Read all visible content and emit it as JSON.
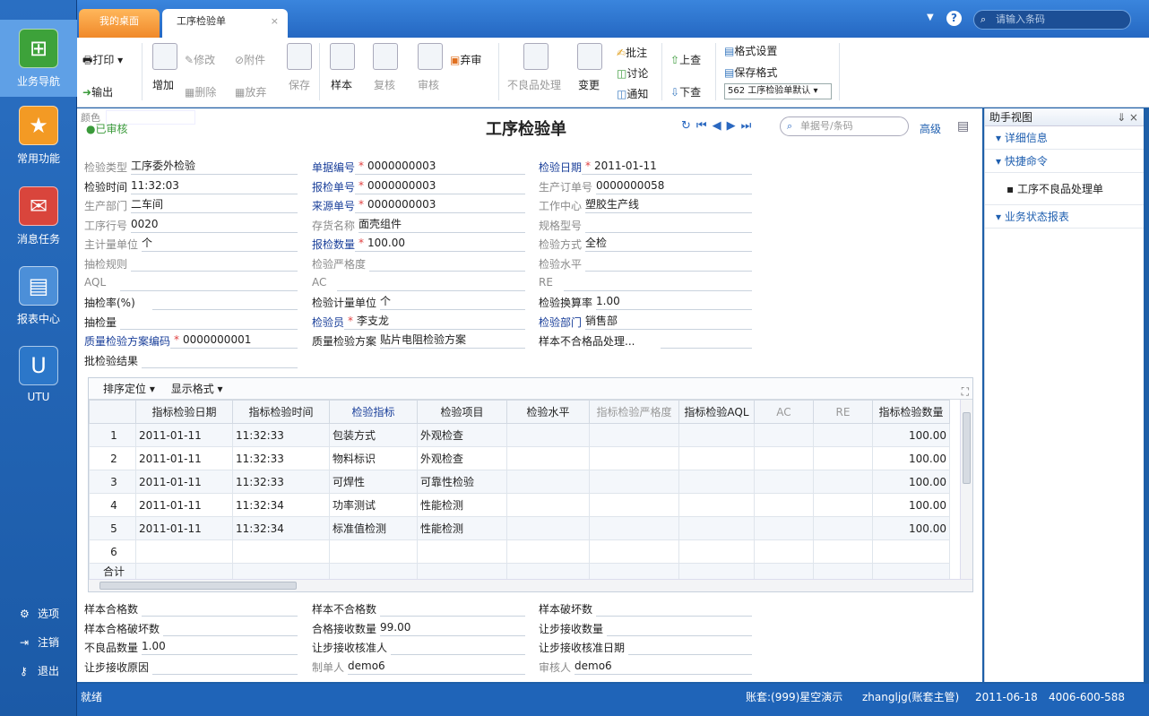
{
  "nav": {
    "items": [
      {
        "label": "业务导航"
      },
      {
        "label": "常用功能"
      },
      {
        "label": "消息任务"
      },
      {
        "label": "报表中心"
      },
      {
        "label": "UTU"
      }
    ],
    "bottom": [
      {
        "label": "选项"
      },
      {
        "label": "注销"
      },
      {
        "label": "退出"
      }
    ]
  },
  "tabs": {
    "home": "我的桌面",
    "current": "工序检验单"
  },
  "search": {
    "placeholder": "请输入条码"
  },
  "toolbar": {
    "print": "打印",
    "export": "输出",
    "add": "增加",
    "edit": "修改",
    "attach": "附件",
    "delete": "删除",
    "abandon": "放弃",
    "save": "保存",
    "sample": "样本",
    "recheck": "复核",
    "audit": "审核",
    "discard": "弃审",
    "defect": "不良品处理",
    "change": "变更",
    "annotate": "批注",
    "discuss": "讨论",
    "notify": "通知",
    "up": "上查",
    "down": "下查",
    "format_set": "格式设置",
    "save_format": "保存格式",
    "format_select": "562 工序检验单默认"
  },
  "doc": {
    "status": "已审核",
    "color_label": "颜色",
    "title": "工序检验单",
    "search_placeholder": "单据号/条码",
    "advanced": "高级"
  },
  "form": {
    "r1": [
      [
        "检验类型",
        "工序委外检验"
      ],
      [
        "单据编号",
        "0000000003"
      ],
      [
        "检验日期",
        "2011-01-11"
      ]
    ],
    "r2": [
      [
        "检验时间",
        "11:32:03"
      ],
      [
        "报检单号",
        "0000000003"
      ],
      [
        "生产订单号",
        "0000000058"
      ]
    ],
    "r3": [
      [
        "生产部门",
        "二车间"
      ],
      [
        "来源单号",
        "0000000003"
      ],
      [
        "工作中心",
        "塑胶生产线"
      ]
    ],
    "r4": [
      [
        "工序行号",
        "0020"
      ],
      [
        "存货名称",
        "面壳组件"
      ],
      [
        "规格型号",
        ""
      ]
    ],
    "r5": [
      [
        "主计量单位",
        "个"
      ],
      [
        "报检数量",
        "100.00"
      ],
      [
        "检验方式",
        "全检"
      ]
    ],
    "r6": [
      [
        "抽检规则",
        ""
      ],
      [
        "检验严格度",
        ""
      ],
      [
        "检验水平",
        ""
      ]
    ],
    "r7": [
      [
        "AQL",
        ""
      ],
      [
        "AC",
        ""
      ],
      [
        "RE",
        ""
      ]
    ],
    "r8": [
      [
        "抽检率(%)",
        ""
      ],
      [
        "检验计量单位",
        "个"
      ],
      [
        "检验换算率",
        "1.00"
      ]
    ],
    "r9": [
      [
        "抽检量",
        ""
      ],
      [
        "检验员",
        "李支龙"
      ],
      [
        "检验部门",
        "销售部"
      ]
    ],
    "r10": [
      [
        "质量检验方案编码",
        "0000000001"
      ],
      [
        "质量检验方案",
        "贴片电阻检验方案"
      ],
      [
        "样本不合格品处理...",
        ""
      ]
    ],
    "r11": [
      [
        "批检验结果",
        ""
      ]
    ],
    "b1": [
      [
        "样本合格数",
        ""
      ],
      [
        "样本不合格数",
        ""
      ],
      [
        "样本破坏数",
        ""
      ]
    ],
    "b2": [
      [
        "样本合格破坏数",
        ""
      ],
      [
        "合格接收数量",
        "99.00"
      ],
      [
        "让步接收数量",
        ""
      ]
    ],
    "b3": [
      [
        "不良品数量",
        "1.00"
      ],
      [
        "让步接收核准人",
        ""
      ],
      [
        "让步接收核准日期",
        ""
      ]
    ],
    "b4": [
      [
        "让步接收原因",
        ""
      ],
      [
        "制单人",
        "demo6"
      ],
      [
        "审核人",
        "demo6"
      ]
    ]
  },
  "grid": {
    "sort": "排序定位",
    "format": "显示格式",
    "headers": [
      "指标检验日期",
      "指标检验时间",
      "检验指标",
      "检验项目",
      "检验水平",
      "指标检验严格度",
      "指标检验AQL",
      "AC",
      "RE",
      "指标检验数量"
    ],
    "rows": [
      [
        "1",
        "2011-01-11",
        "11:32:33",
        "包装方式",
        "外观检查",
        "",
        "",
        "",
        "",
        "",
        "100.00"
      ],
      [
        "2",
        "2011-01-11",
        "11:32:33",
        "物料标识",
        "外观检查",
        "",
        "",
        "",
        "",
        "",
        "100.00"
      ],
      [
        "3",
        "2011-01-11",
        "11:32:33",
        "可焊性",
        "可靠性检验",
        "",
        "",
        "",
        "",
        "",
        "100.00"
      ],
      [
        "4",
        "2011-01-11",
        "11:32:34",
        "功率测试",
        "性能检测",
        "",
        "",
        "",
        "",
        "",
        "100.00"
      ],
      [
        "5",
        "2011-01-11",
        "11:32:34",
        "标准值检测",
        "性能检测",
        "",
        "",
        "",
        "",
        "",
        "100.00"
      ],
      [
        "6",
        "",
        "",
        "",
        "",
        "",
        "",
        "",
        "",
        "",
        ""
      ]
    ],
    "total": "合计"
  },
  "helper": {
    "title": "助手视图",
    "sections": [
      "详细信息",
      "快捷命令",
      "业务状态报表"
    ],
    "link": "工序不良品处理单"
  },
  "status": {
    "ready": "就绪",
    "account": "账套:(999)星空演示",
    "user": "zhangljg(账套主管)",
    "date": "2011-06-18",
    "phone": "4006-600-588"
  }
}
